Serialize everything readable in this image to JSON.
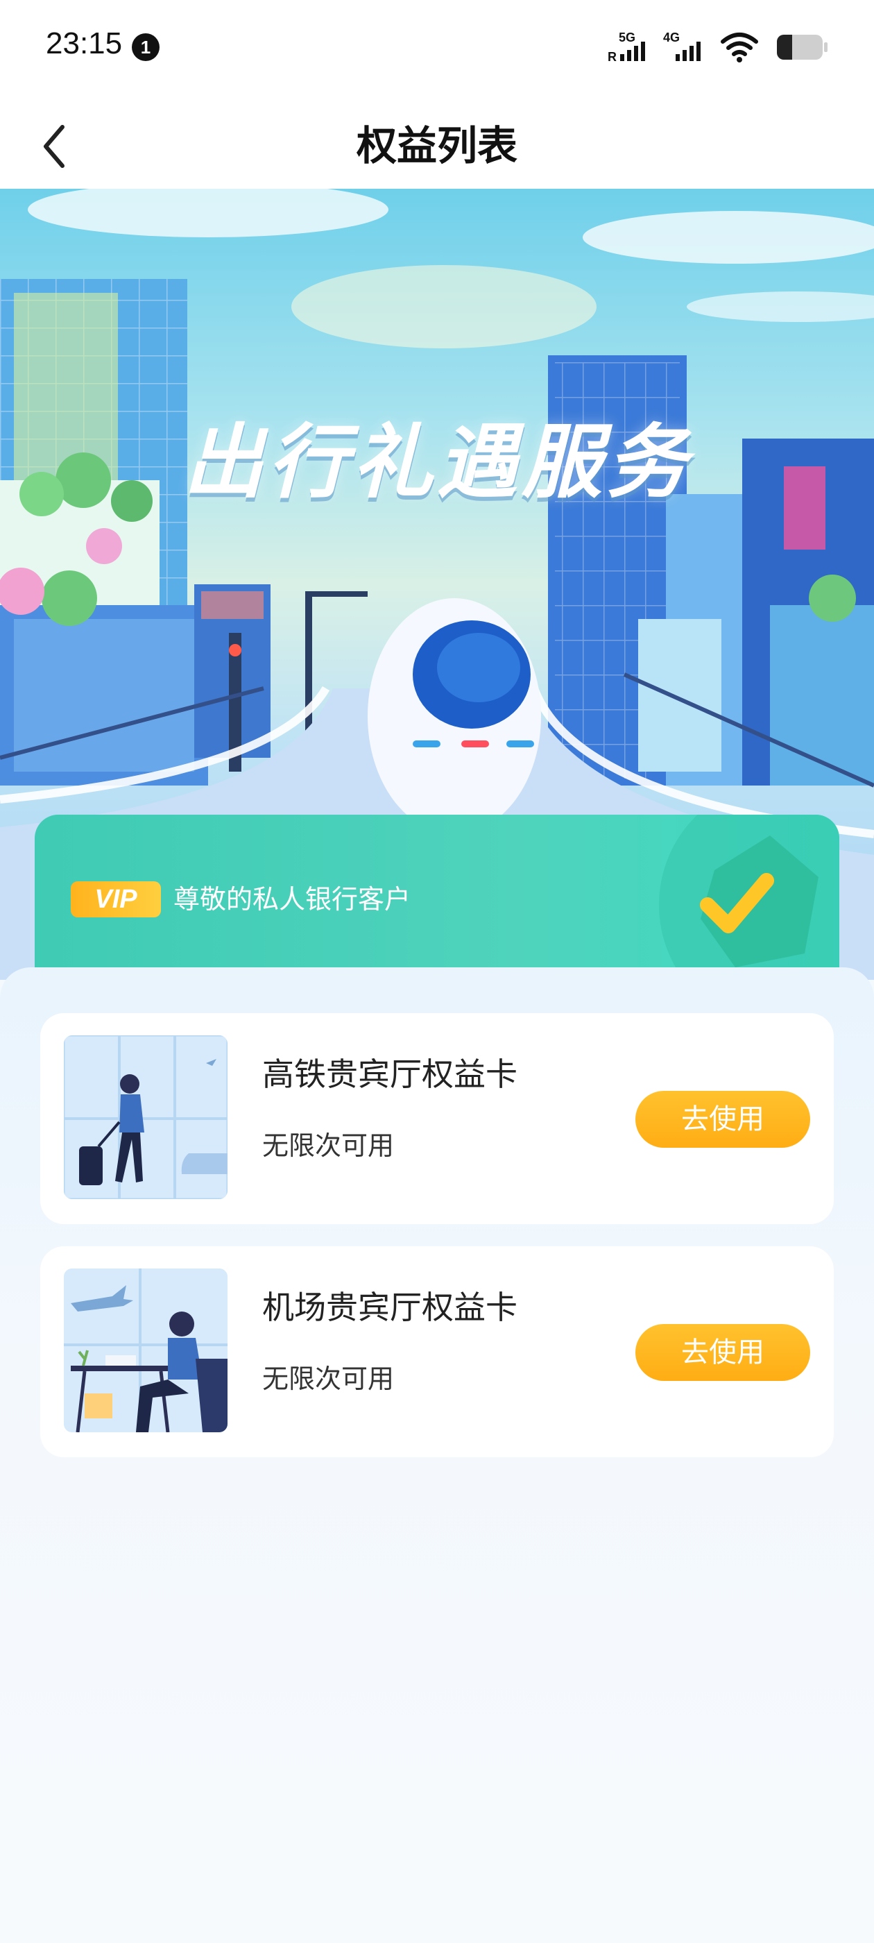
{
  "status_bar": {
    "time": "23:15",
    "notification_count": "1",
    "network_1": "5G",
    "network_1_sub": "R",
    "network_2": "4G",
    "icons": [
      "signal-5g-icon",
      "signal-4g-icon",
      "wifi-icon",
      "battery-icon"
    ]
  },
  "nav": {
    "title": "权益列表",
    "back_icon": "chevron-left-icon"
  },
  "hero": {
    "title": "出行礼遇服务"
  },
  "vip": {
    "badge": "VIP",
    "text": "尊敬的私人银行客户"
  },
  "benefits": [
    {
      "title": "高铁贵宾厅权益卡",
      "subtitle": "无限次可用",
      "button_label": "去使用",
      "thumb_icon": "traveler-with-luggage-illustration"
    },
    {
      "title": "机场贵宾厅权益卡",
      "subtitle": "无限次可用",
      "button_label": "去使用",
      "thumb_icon": "airport-lounge-illustration"
    }
  ],
  "colors": {
    "accent_orange": "#ffb31d",
    "vip_green": "#45cfb9",
    "page_bg": "#f4f9fe"
  }
}
